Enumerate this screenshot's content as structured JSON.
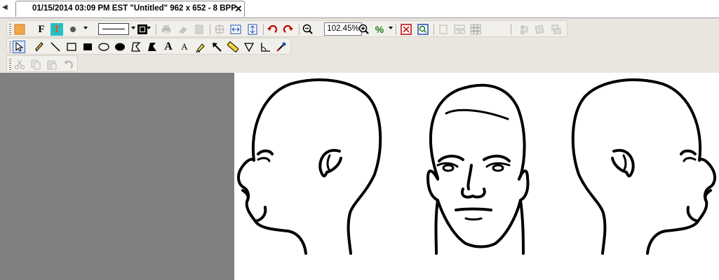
{
  "tab": {
    "title": "01/15/2014 03:09 PM EST \"Untitled\" 962 x 652 - 8 BPP",
    "close_glyph": "✕"
  },
  "toolbar": {
    "zoom_value": "102.45%",
    "percent_label": "%",
    "bold_font_label": "F",
    "text_color_label": "T"
  },
  "draw_tools": {
    "text_tool_label": "A",
    "text_style_label": "A"
  },
  "colors": {
    "tool_background": "#e9e6df",
    "workspace_gray": "#808080",
    "accent_red": "#c00000",
    "accent_blue": "#1e4fb3"
  }
}
